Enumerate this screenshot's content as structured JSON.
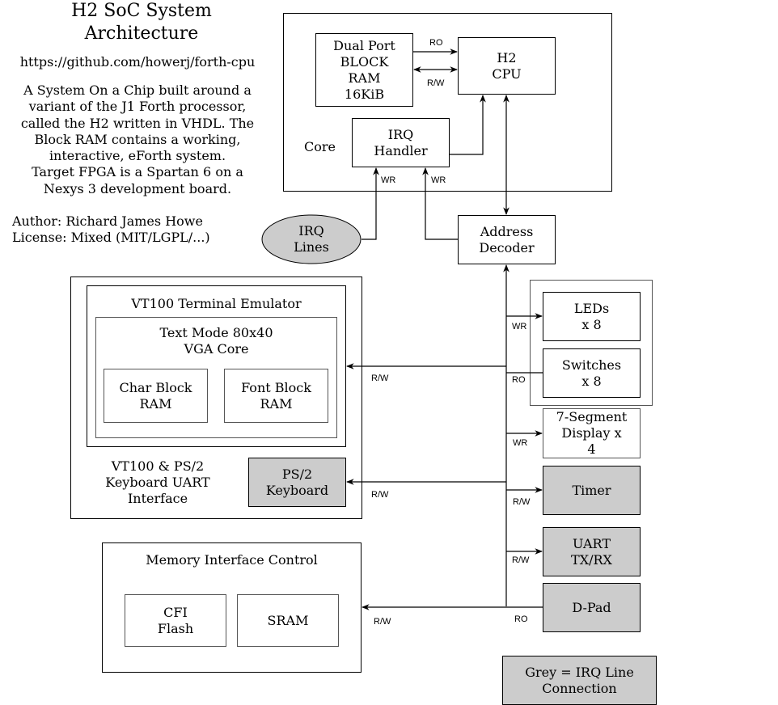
{
  "header": {
    "title": "H2 SoC System\nArchitecture",
    "url": "https://github.com/howerj/forth-cpu",
    "description": "A System On a Chip built around a\nvariant of the J1 Forth processor,\ncalled the H2 written in VHDL. The\nBlock RAM contains a working,\ninteractive, eForth system.\nTarget FPGA is a Spartan 6 on a\nNexys 3 development board.",
    "author": "Author: Richard James Howe",
    "license": "License: Mixed (MIT/LGPL/...)"
  },
  "core": {
    "label": "Core",
    "block_ram": "Dual Port\nBLOCK\nRAM\n16KiB",
    "cpu": "H2\nCPU",
    "irq_handler": "IRQ\nHandler"
  },
  "irq_lines": "IRQ\nLines",
  "address_decoder": "Address\nDecoder",
  "vt100_group": {
    "label": "VT100 & PS/2\nKeyboard UART\nInterface",
    "terminal": "VT100 Terminal Emulator",
    "vga_core": "Text Mode 80x40\nVGA Core",
    "char_ram": "Char Block\nRAM",
    "font_ram": "Font Block\nRAM",
    "ps2": "PS/2\nKeyboard"
  },
  "memory_group": {
    "label": "Memory Interface Control",
    "flash": "CFI\nFlash",
    "sram": "SRAM"
  },
  "peripherals": {
    "leds": "LEDs\nx 8",
    "switches": "Switches\nx 8",
    "seven_seg": "7-Segment\nDisplay x\n4",
    "timer": "Timer",
    "uart": "UART\nTX/RX",
    "dpad": "D-Pad"
  },
  "legend": "Grey = IRQ Line\nConnection",
  "edge_labels": {
    "ram_cpu_ro": "RO",
    "ram_cpu_rw": "R/W",
    "irq_wr_1": "WR",
    "irq_wr_2": "WR",
    "leds": "WR",
    "switches": "RO",
    "vga": "R/W",
    "seven_seg": "WR",
    "ps2": "R/W",
    "timer": "R/W",
    "uart": "R/W",
    "memory": "R/W",
    "dpad": "RO"
  },
  "colors": {
    "irq_grey": "#cccccc",
    "line": "#000000"
  }
}
